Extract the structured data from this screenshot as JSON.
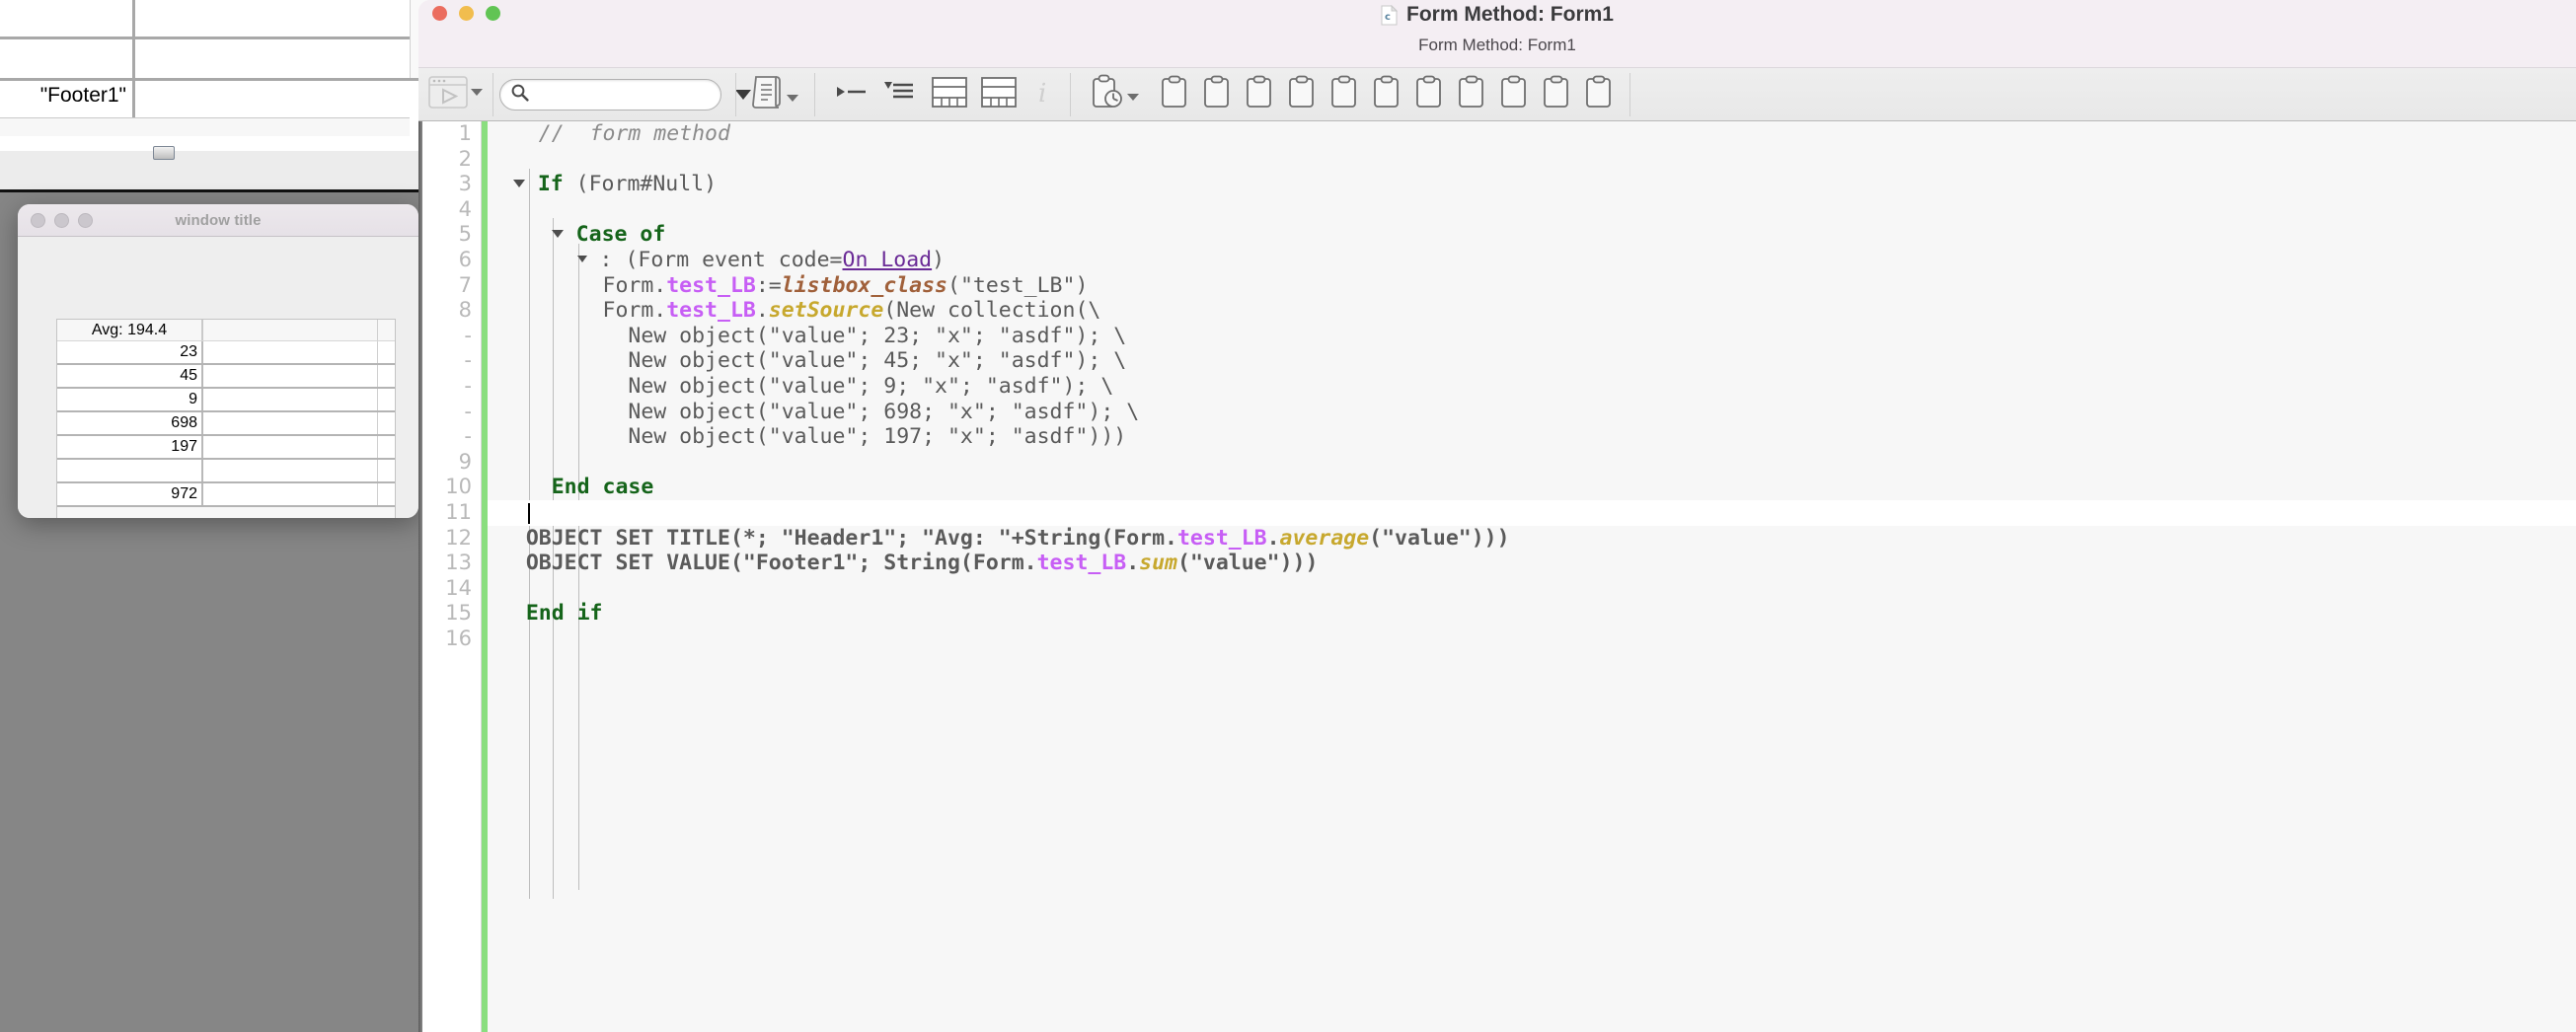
{
  "designer_window": {
    "name": "form-designer-window",
    "footer_cell_text": "\"Footer1\""
  },
  "dialog": {
    "title": "window title",
    "listbox": {
      "header": "Avg: 194.4",
      "rows": [
        "23",
        "45",
        "9",
        "698",
        "197",
        ""
      ],
      "footer": "972"
    }
  },
  "window": {
    "title": "Form Method: Form1",
    "subtitle": "Form Method: Form1",
    "doc_icon_letter": "c",
    "traffic_lights": [
      "close-button",
      "minimize-button",
      "zoom-button"
    ]
  },
  "toolbar": {
    "run_button_label": "run-method",
    "search_placeholder": "",
    "search_value": "",
    "items": [
      {
        "name": "run-method-button",
        "icon": "play-window-icon"
      },
      {
        "name": "search-field",
        "icon": "search-icon"
      },
      {
        "name": "macros-button",
        "icon": "scroll-document-icon"
      },
      {
        "name": "step-over-button",
        "icon": "step-arrow-icon"
      },
      {
        "name": "list-button",
        "icon": "list-lines-icon"
      },
      {
        "name": "table-button-1",
        "icon": "table-icon"
      },
      {
        "name": "table-button-2",
        "icon": "table-icon"
      },
      {
        "name": "info-button",
        "icon": "info-italic-icon"
      },
      {
        "name": "history-clipboard-button",
        "icon": "clipboard-clock-icon"
      },
      {
        "name": "clipboard-1",
        "icon": "clipboard-icon"
      },
      {
        "name": "clipboard-2",
        "icon": "clipboard-icon"
      },
      {
        "name": "clipboard-3",
        "icon": "clipboard-icon"
      },
      {
        "name": "clipboard-4",
        "icon": "clipboard-icon"
      },
      {
        "name": "clipboard-5",
        "icon": "clipboard-icon"
      },
      {
        "name": "clipboard-6",
        "icon": "clipboard-icon"
      },
      {
        "name": "clipboard-7",
        "icon": "clipboard-icon"
      },
      {
        "name": "clipboard-8",
        "icon": "clipboard-icon"
      },
      {
        "name": "clipboard-9",
        "icon": "clipboard-icon"
      },
      {
        "name": "clipboard-10",
        "icon": "clipboard-icon"
      },
      {
        "name": "clipboard-11",
        "icon": "clipboard-icon"
      }
    ]
  },
  "editor": {
    "gutter_numbers": [
      "1",
      "2",
      "3",
      "4",
      "5",
      "6",
      "7",
      "8",
      "-",
      "-",
      "-",
      "-",
      "-",
      "9",
      "10",
      "11",
      "12",
      "13",
      "14",
      "15",
      "16"
    ],
    "current_line": 11,
    "lines": [
      {
        "n": "1",
        "text": "    //  form method"
      },
      {
        "n": "2",
        "text": ""
      },
      {
        "n": "3",
        "text": "  If (Form#Null)"
      },
      {
        "n": "4",
        "text": ""
      },
      {
        "n": "5",
        "text": "   Case of"
      },
      {
        "n": "6",
        "text": "    : (Form event code=On Load)"
      },
      {
        "n": "7",
        "text": "      Form.test_LB:=listbox_class(\"test_LB\")"
      },
      {
        "n": "8",
        "text": "      Form.test_LB.setSource(New collection(\\"
      },
      {
        "n": "-",
        "text": "        New object(\"value\"; 23; \"x\"; \"asdf\"); \\"
      },
      {
        "n": "-",
        "text": "        New object(\"value\"; 45; \"x\"; \"asdf\"); \\"
      },
      {
        "n": "-",
        "text": "        New object(\"value\"; 9; \"x\"; \"asdf\"); \\"
      },
      {
        "n": "-",
        "text": "        New object(\"value\"; 698; \"x\"; \"asdf\"); \\"
      },
      {
        "n": "-",
        "text": "        New object(\"value\"; 197; \"x\"; \"asdf\")))"
      },
      {
        "n": "9",
        "text": ""
      },
      {
        "n": "10",
        "text": "   End case"
      },
      {
        "n": "11",
        "text": ""
      },
      {
        "n": "12",
        "text": "  OBJECT SET TITLE(*; \"Header1\"; \"Avg: \"+String(Form.test_LB.average(\"value\")))"
      },
      {
        "n": "13",
        "text": "  OBJECT SET VALUE(\"Footer1\"; String(Form.test_LB.sum(\"value\")))"
      },
      {
        "n": "14",
        "text": ""
      },
      {
        "n": "15",
        "text": "  End if"
      },
      {
        "n": "16",
        "text": ""
      }
    ]
  },
  "colors": {
    "keyword_green": "#15641a",
    "property_purple": "#c75ef5",
    "class_brown": "#a0603a",
    "function_gold": "#c7a82e",
    "event_violet": "#6a2a96",
    "plain_gray": "#5a5a5a",
    "comment_gray": "#8b8b8b",
    "green_bar": "#8ade7f",
    "titlebar_bg": "#f4eef3",
    "desktop_bg": "#868686"
  }
}
